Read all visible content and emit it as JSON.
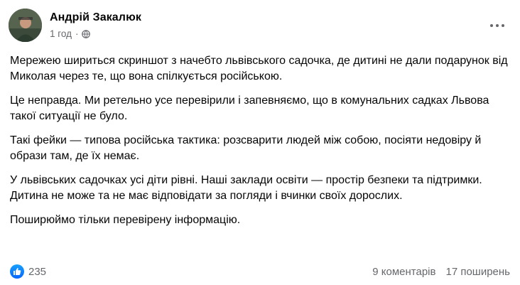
{
  "post": {
    "author": "Андрій Закалюк",
    "time": "1 год",
    "dot": "·",
    "paragraphs": [
      "Мережею шириться скриншот з начебто львівського садочка, де дитині не дали подарунок від Миколая через те, що вона спілкується російською.",
      "Це неправда. Ми ретельно усе перевірили і запевняємо, що в комунальних садках Львова такої ситуації не було.",
      "Такі фейки — типова російська тактика: розсварити людей між собою, посіяти недовіру й образи там, де їх немає.",
      "У львівських садочках усі діти рівні. Наші заклади освіти — простір безпеки та підтримки. Дитина не може та не має відповідати за погляди і вчинки своїх дорослих.",
      "Поширюймо тільки перевірену інформацію."
    ]
  },
  "footer": {
    "likes": "235",
    "comments": "9 коментарів",
    "shares": "17 поширень"
  },
  "icons": {
    "avatar": "avatar",
    "privacy": "globe-icon",
    "more": "more-options-icon",
    "reaction": "like-icon"
  },
  "colors": {
    "secondary_text": "#65676b",
    "primary_text": "#050505",
    "like_blue": "#0866ff"
  }
}
